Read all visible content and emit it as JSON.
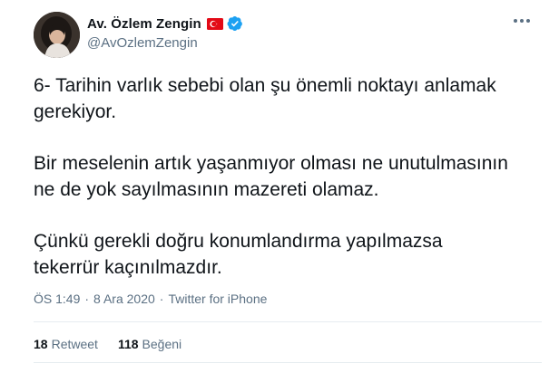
{
  "author": {
    "display_name": "Av. Özlem Zengin",
    "handle": "@AvOzlemZengin",
    "flag_icon": "turkey-flag-icon",
    "verified_icon": "verified-badge-icon"
  },
  "tweet": {
    "paragraph_1_line_1": "6- Tarihin varlık sebebi olan şu önemli noktayı anlamak",
    "paragraph_1_line_2": "gerekiyor.",
    "paragraph_2_line_1": "Bir meselenin artık yaşanmıyor olması ne unutulmasının",
    "paragraph_2_line_2": "ne de yok sayılmasının mazereti olamaz.",
    "paragraph_3_line_1": "Çünkü gerekli doğru konumlandırma yapılmazsa",
    "paragraph_3_line_2": "tekerrür kaçınılmazdır."
  },
  "meta": {
    "time": "ÖS 1:49",
    "separator": "·",
    "date": "8 Ara 2020",
    "source": "Twitter for iPhone"
  },
  "stats": {
    "retweet_count": "18",
    "retweet_label": "Retweet",
    "like_count": "118",
    "like_label": "Beğeni"
  },
  "colors": {
    "text": "#0f1419",
    "secondary": "#5b7083",
    "verified": "#1da1f2",
    "flag_red": "#e30a17",
    "divider": "#e6ecf0"
  }
}
